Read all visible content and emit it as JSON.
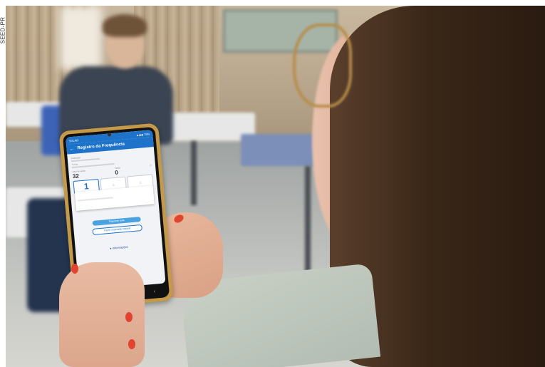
{
  "credit": "SEED-PR",
  "phone": {
    "status_left": "SOLAR",
    "status_right": "▲◆◆ 79%",
    "app_title": "Registro da Frequência",
    "field_labels": [
      "Instituição",
      "Turma",
      "Estudante"
    ],
    "counts": [
      {
        "label": "Total de aulas",
        "value": "32"
      },
      {
        "label": "Faltas",
        "value": "0"
      }
    ],
    "tiles": [
      "1"
    ],
    "buttons": {
      "primary": "Registrar aula",
      "secondary": "Fazer chamada manual"
    },
    "link": "Informações"
  },
  "colors": {
    "app_blue": "#1d72c9",
    "phone_case": "#c49a4a",
    "nail_polish": "#e0442f",
    "sweater": "#c9d1c7"
  }
}
